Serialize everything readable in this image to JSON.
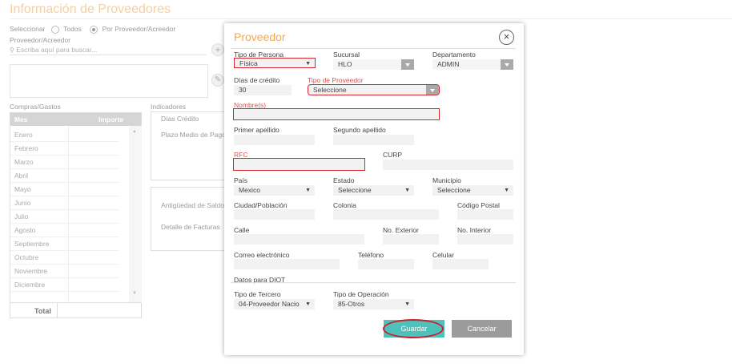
{
  "page": {
    "title": "Información de Proveedores",
    "select_label": "Seleccionar",
    "radio_all": "Todos",
    "radio_by_supplier": "Por Proveedor/Acreedor",
    "supplier_label": "Proveedor/Acreedor",
    "search_placeholder": "Escriba aquí para buscar...",
    "purchases_label": "Compras/Gastos",
    "indicators_label": "Indicadores",
    "table": {
      "headers": [
        "Mes",
        "Importe"
      ],
      "months": [
        "Enero",
        "Febrero",
        "Marzo",
        "Abril",
        "Mayo",
        "Junio",
        "Julio",
        "Agosto",
        "Septiembre",
        "Octubre",
        "Noviembre",
        "Diciembre"
      ],
      "total_label": "Total"
    },
    "indicators": {
      "credit_days": "Días Crédito",
      "avg_payment_term": "Plazo Medio de Pago",
      "balance_age": "Antigüedad de Saldo",
      "invoice_detail": "Detalle de Facturas"
    }
  },
  "modal": {
    "title": "Proveedor",
    "close_icon": "×",
    "fields": {
      "person_type": {
        "label": "Tipo de Persona",
        "value": "Física"
      },
      "branch": {
        "label": "Sucursal",
        "value": "HLO"
      },
      "department": {
        "label": "Departamento",
        "value": "ADMIN"
      },
      "credit_days": {
        "label": "Días de crédito",
        "value": "30"
      },
      "supplier_type": {
        "label": "Tipo de Proveedor",
        "value": "Seleccione"
      },
      "names": {
        "label": "Nombre(s)",
        "value": ""
      },
      "first_surname": {
        "label": "Primer apellido",
        "value": ""
      },
      "second_surname": {
        "label": "Segundo apellido",
        "value": ""
      },
      "rfc": {
        "label": "RFC",
        "value": ""
      },
      "curp": {
        "label": "CURP",
        "value": ""
      },
      "country": {
        "label": "País",
        "value": "Mexico"
      },
      "state": {
        "label": "Estado",
        "value": "Seleccione"
      },
      "municipality": {
        "label": "Municipio",
        "value": "Seleccione"
      },
      "city": {
        "label": "Ciudad/Población",
        "value": ""
      },
      "neighborhood": {
        "label": "Colonia",
        "value": ""
      },
      "zip": {
        "label": "Código Postal",
        "value": ""
      },
      "street": {
        "label": "Calle",
        "value": ""
      },
      "ext_number": {
        "label": "No. Exterior",
        "value": ""
      },
      "int_number": {
        "label": "No. Interior",
        "value": ""
      },
      "email": {
        "label": "Correo electrónico",
        "value": ""
      },
      "phone": {
        "label": "Teléfono",
        "value": ""
      },
      "mobile": {
        "label": "Celular",
        "value": ""
      }
    },
    "diot_section": "Datos para DIOT",
    "third_party_type": {
      "label": "Tipo de Tercero",
      "value": "04-Proveedor Nacio"
    },
    "operation_type": {
      "label": "Tipo de Operación",
      "value": "85-Otros"
    },
    "buttons": {
      "save": "Guardar",
      "cancel": "Cancelar"
    }
  },
  "colors": {
    "accent": "#f0a855",
    "save": "#4fc1bb",
    "cancel": "#9b9b9b",
    "highlight": "#d7262e"
  }
}
